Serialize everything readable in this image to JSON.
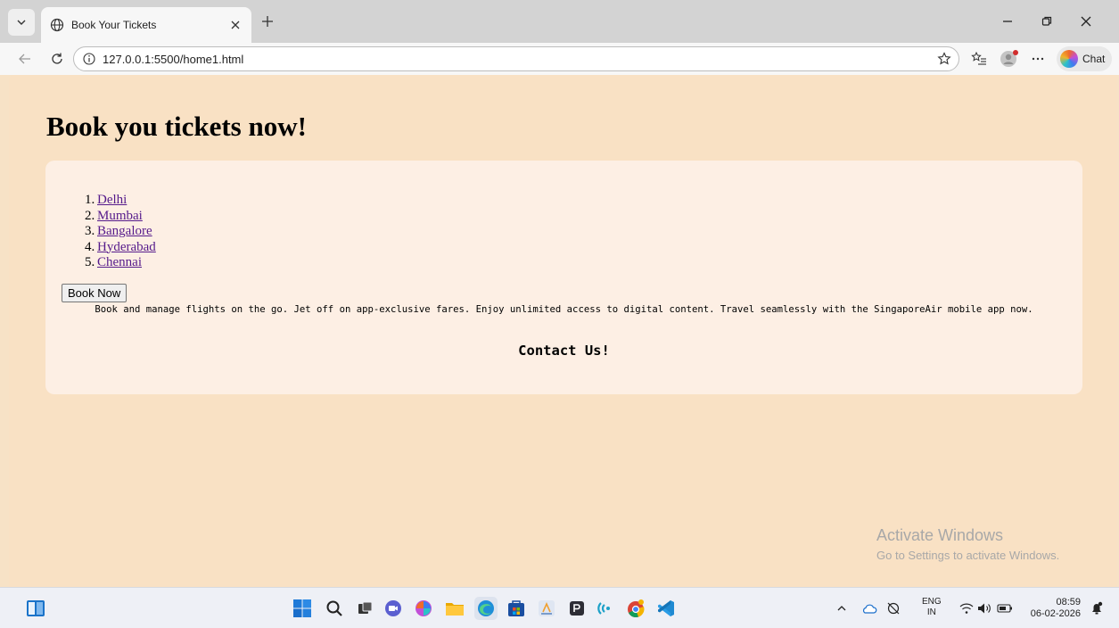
{
  "browser": {
    "tab": {
      "title": "Book Your Tickets"
    },
    "address": {
      "url": "127.0.0.1:5500/home1.html"
    },
    "chat_label": "Chat"
  },
  "page": {
    "heading": "Book you tickets now!",
    "cities": [
      {
        "num": "1.",
        "label": "Delhi"
      },
      {
        "num": "2.",
        "label": "Mumbai"
      },
      {
        "num": "3.",
        "label": "Bangalore"
      },
      {
        "num": "4.",
        "label": "Hyderabad"
      },
      {
        "num": "5.",
        "label": "Chennai"
      }
    ],
    "book_button": "Book Now",
    "promo_text": "Book and manage flights on the go. Jet off on app-exclusive fares. Enjoy unlimited access to digital content. Travel seamlessly with the SingaporeAir mobile app now.",
    "contact": "Contact Us!"
  },
  "watermark": {
    "line1": "Activate Windows",
    "line2": "Go to Settings to activate Windows."
  },
  "taskbar": {
    "lang_top": "ENG",
    "lang_bottom": "IN",
    "time": "08:59",
    "date": "06-02-2026"
  },
  "colors": {
    "page_bg": "#f9e1c4",
    "card_bg": "#fdefe4",
    "link": "#551a8b"
  }
}
